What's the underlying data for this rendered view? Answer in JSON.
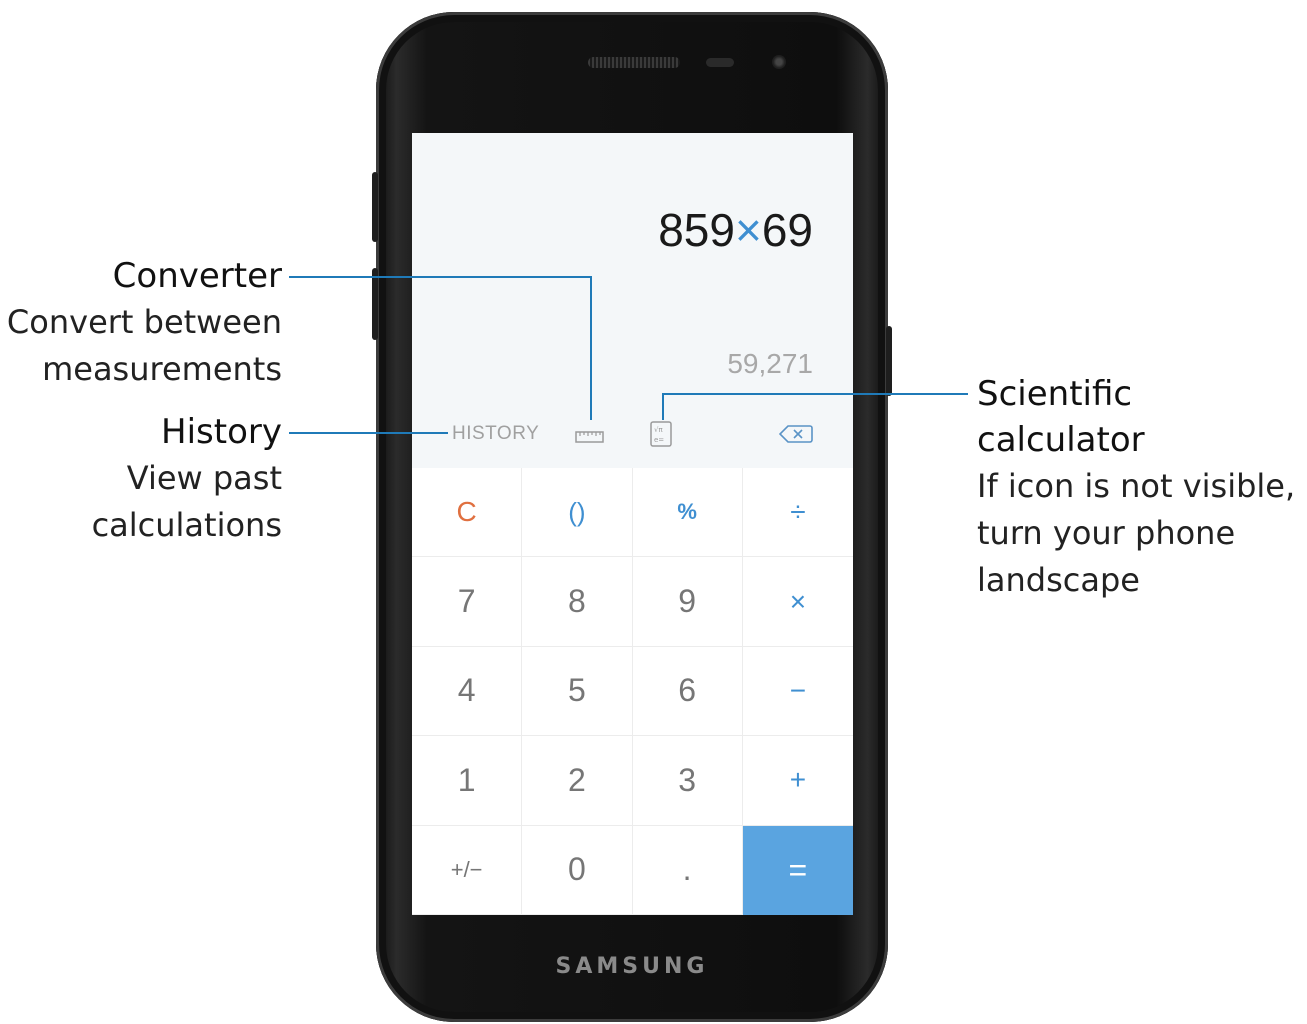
{
  "callouts": {
    "converter": {
      "title": "Converter",
      "desc_line1": "Convert between",
      "desc_line2": "measurements"
    },
    "history": {
      "title": "History",
      "desc_line1": "View past",
      "desc_line2": "calculations"
    },
    "scientific": {
      "title": "Scientific calculator",
      "desc_line1": "If icon is not visible,",
      "desc_line2": "turn your phone",
      "desc_line3": "landscape"
    }
  },
  "phone": {
    "brand": "SAMSUNG"
  },
  "calculator": {
    "expression": {
      "left": "859",
      "operator": "×",
      "right": "69"
    },
    "result": "59,271",
    "toolbar": {
      "history_label": "HISTORY",
      "icons": [
        "ruler-icon",
        "scientific-icon",
        "backspace-icon"
      ]
    },
    "keys": {
      "row1": [
        "C",
        "()",
        "%",
        "÷"
      ],
      "row2": [
        "7",
        "8",
        "9",
        "×"
      ],
      "row3": [
        "4",
        "5",
        "6",
        "−"
      ],
      "row4": [
        "1",
        "2",
        "3",
        "+"
      ],
      "row5": [
        "+/−",
        "0",
        ".",
        "="
      ]
    }
  },
  "colors": {
    "accent": "#3f8fd1",
    "clear": "#e07040",
    "equals_bg": "#5aa4e0",
    "leader_line": "#1f7ab8"
  }
}
